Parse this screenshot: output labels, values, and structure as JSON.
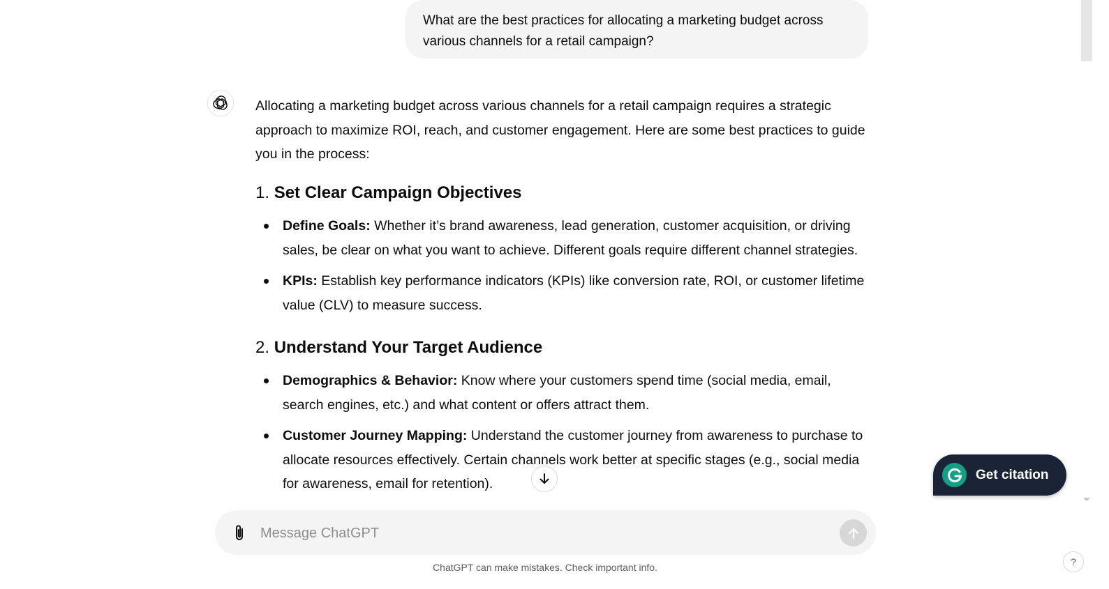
{
  "user_message": {
    "text": "What are the best practices for allocating a marketing budget across various channels for a retail campaign?"
  },
  "assistant": {
    "intro": "Allocating a marketing budget across various channels for a retail campaign requires a strategic approach to maximize ROI, reach, and customer engagement. Here are some best practices to guide you in the process:",
    "sections": [
      {
        "number": "1.",
        "title": "Set Clear Campaign Objectives",
        "bullets": [
          {
            "term": "Define Goals:",
            "text": " Whether it’s brand awareness, lead generation, customer acquisition, or driving sales, be clear on what you want to achieve. Different goals require different channel strategies."
          },
          {
            "term": "KPIs:",
            "text": " Establish key performance indicators (KPIs) like conversion rate, ROI, or customer lifetime value (CLV) to measure success."
          }
        ]
      },
      {
        "number": "2.",
        "title": "Understand Your Target Audience",
        "bullets": [
          {
            "term": "Demographics & Behavior:",
            "text": " Know where your customers spend time (social media, email, search engines, etc.) and what content or offers attract them."
          },
          {
            "term": "Customer Journey Mapping:",
            "text": " Understand the customer journey from awareness to purchase to allocate resources effectively. Certain channels work better at specific stages (e.g., social media for awareness, email for retention)."
          }
        ]
      }
    ]
  },
  "composer": {
    "placeholder": "Message ChatGPT"
  },
  "disclaimer": "ChatGPT can make mistakes. Check important info.",
  "citation_button": {
    "label": "Get citation"
  },
  "help": {
    "label": "?"
  },
  "icons": {
    "avatar": "openai-logo-icon",
    "scroll": "arrow-down-icon",
    "attach": "paperclip-icon",
    "send": "arrow-up-icon",
    "citation": "grammarly-g-icon"
  },
  "colors": {
    "bubble": "#f4f4f4",
    "citation_bg": "#1b2336",
    "citation_logo": "#15a085",
    "send_disabled": "#d7d7d7"
  }
}
